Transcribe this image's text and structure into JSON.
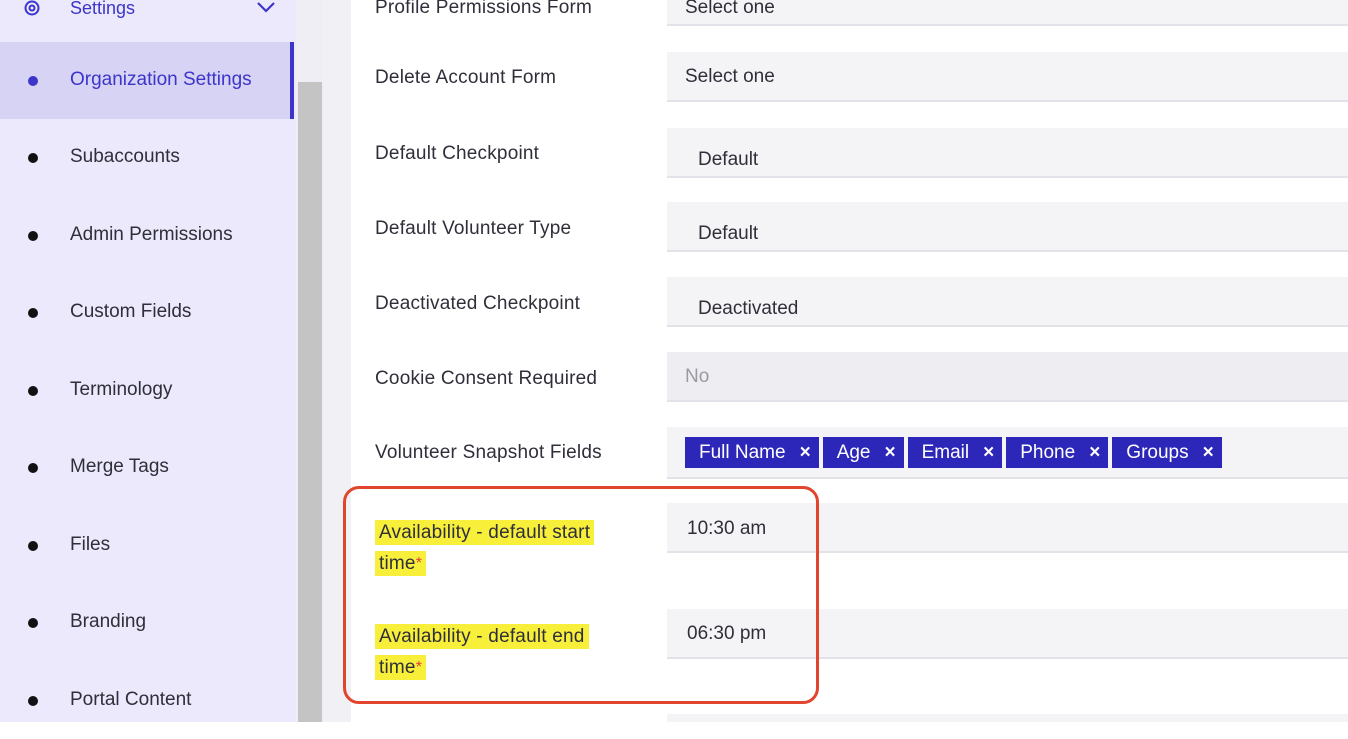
{
  "sidebar": {
    "section_label": "Settings",
    "items": [
      {
        "label": "Organization Settings",
        "active": true
      },
      {
        "label": "Subaccounts"
      },
      {
        "label": "Admin Permissions"
      },
      {
        "label": "Custom Fields"
      },
      {
        "label": "Terminology"
      },
      {
        "label": "Merge Tags"
      },
      {
        "label": "Files"
      },
      {
        "label": "Branding"
      },
      {
        "label": "Portal Content"
      }
    ]
  },
  "form": {
    "profile_permissions": {
      "label": "Profile Permissions Form",
      "value": "Select one"
    },
    "delete_account": {
      "label": "Delete Account Form",
      "value": "Select one"
    },
    "default_checkpoint": {
      "label": "Default Checkpoint",
      "value": "Default"
    },
    "default_volunteer_type": {
      "label": "Default Volunteer Type",
      "value": "Default"
    },
    "deactivated_checkpoint": {
      "label": "Deactivated Checkpoint",
      "value": "Deactivated"
    },
    "cookie_consent": {
      "label": "Cookie Consent Required",
      "value": "No"
    },
    "snapshot_fields": {
      "label": "Volunteer Snapshot Fields",
      "chips": [
        "Full Name",
        "Age",
        "Email",
        "Phone",
        "Groups"
      ]
    },
    "availability_start": {
      "label_line1": "Availability - default start",
      "label_line2": "time",
      "required_mark": "*",
      "value": "10:30 am"
    },
    "availability_end": {
      "label_line1": "Availability - default end",
      "label_line2": "time",
      "required_mark": "*",
      "value": "06:30 pm"
    }
  },
  "icons": {
    "info": "i",
    "chip_remove": "×"
  },
  "colors": {
    "accent": "#2c27b8",
    "sidebar_bg": "#ebe9fb",
    "highlight": "#f7ef3a",
    "callout": "#e2452e",
    "required": "#e83b3b"
  }
}
